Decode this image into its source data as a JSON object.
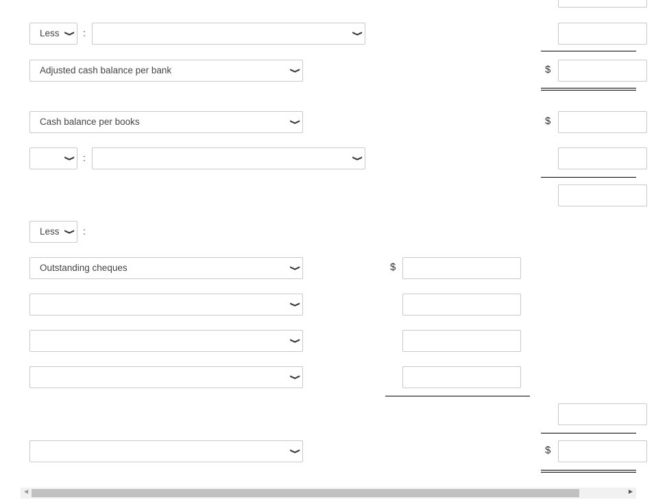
{
  "rows": {
    "less1": {
      "type": "Less",
      "item": ""
    },
    "adjusted_bank": {
      "label": "Adjusted cash balance per bank",
      "currency": "$"
    },
    "books": {
      "label": "Cash balance per books",
      "currency": "$"
    },
    "add1": {
      "type": "",
      "item": ""
    },
    "less2": {
      "type": "Less"
    },
    "outstanding": {
      "label": "Outstanding cheques",
      "currency": "$"
    },
    "blank1": {
      "label": ""
    },
    "blank2": {
      "label": ""
    },
    "blank3": {
      "label": ""
    },
    "final": {
      "label": "",
      "currency": "$"
    }
  },
  "colon": ":",
  "icons": {
    "dropdown": "chevron-down-icon"
  }
}
